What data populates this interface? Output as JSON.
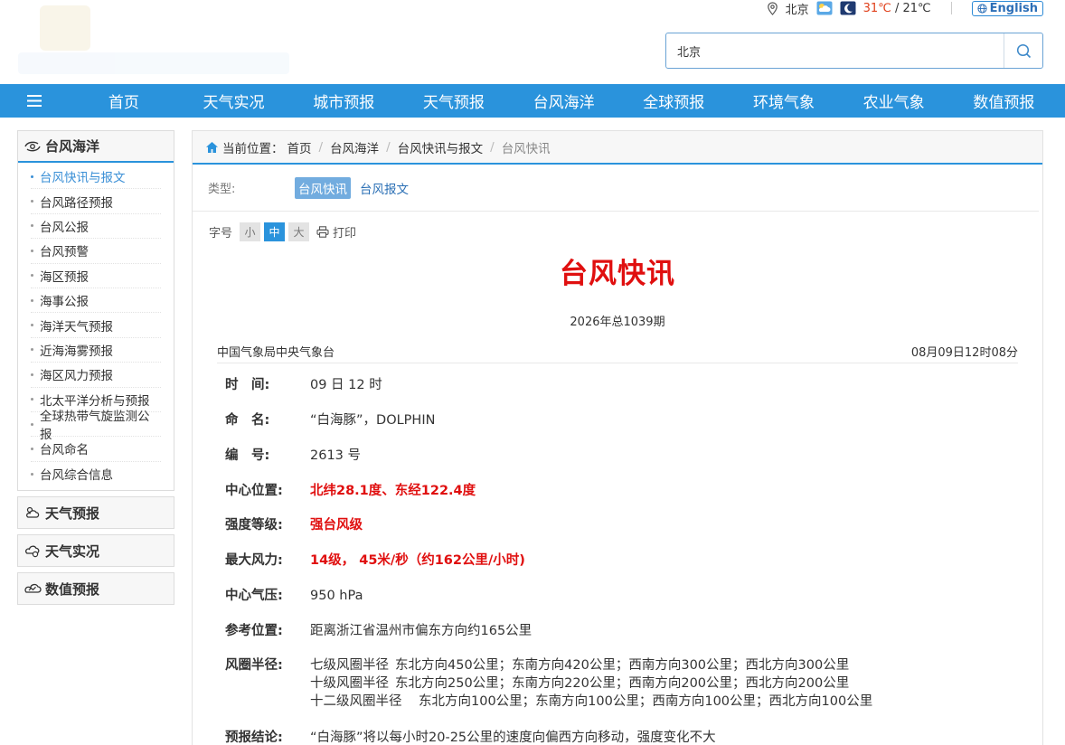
{
  "topbar": {
    "city": "北京",
    "temp_high": "31℃",
    "temp_sep": "/",
    "temp_low": "21℃",
    "english_label": "English"
  },
  "search": {
    "value": "北京"
  },
  "nav": {
    "items": [
      "首页",
      "天气实况",
      "城市预报",
      "天气预报",
      "台风海洋",
      "全球预报",
      "环境气象",
      "农业气象",
      "数值预报"
    ]
  },
  "sidebar": {
    "section_title": "台风海洋",
    "items": [
      {
        "label": "台风快讯与报文",
        "active": true
      },
      {
        "label": "台风路径预报"
      },
      {
        "label": "台风公报"
      },
      {
        "label": "台风预警"
      },
      {
        "label": "海区预报"
      },
      {
        "label": "海事公报"
      },
      {
        "label": "海洋天气预报"
      },
      {
        "label": "近海海雾预报"
      },
      {
        "label": "海区风力预报"
      },
      {
        "label": "北太平洋分析与预报"
      },
      {
        "label": "全球热带气旋监测公报"
      },
      {
        "label": "台风命名"
      },
      {
        "label": "台风综合信息"
      }
    ],
    "categories": [
      "天气预报",
      "天气实况",
      "数值预报"
    ]
  },
  "breadcrumb": {
    "prefix": "当前位置：",
    "items": [
      "首页",
      "台风海洋",
      "台风快讯与报文"
    ],
    "current": "台风快讯"
  },
  "type_filter": {
    "label": "类型:",
    "tags": [
      "台风快讯",
      "台风报文"
    ]
  },
  "font_controls": {
    "label": "字号",
    "small": "小",
    "medium": "中",
    "large": "大",
    "print": "打印"
  },
  "article": {
    "title": "台风快讯",
    "issue": "2026年总1039期",
    "source": "中国气象局中央气象台",
    "time": "08月09日12时08分",
    "rows": [
      {
        "key": "时　间:",
        "value": "09 日 12 时"
      },
      {
        "key": "命　名:",
        "value": "“白海豚”，DOLPHIN"
      },
      {
        "key": "编　号:",
        "value": "2613 号"
      },
      {
        "key": "中心位置:",
        "value": "北纬28.1度、东经122.4度"
      },
      {
        "key": "强度等级:",
        "value": "强台风级"
      },
      {
        "key": "最大风力:",
        "value": "14级， 45米/秒（约162公里/小时)"
      },
      {
        "key": "中心气压:",
        "value": "950 hPa"
      },
      {
        "key": "参考位置:",
        "value": "距离浙江省温州市偏东方向约165公里"
      },
      {
        "key": "风圈半径:",
        "lines": [
          {
            "pre": "七级风圈半径",
            "text": "东北方向450公里；东南方向420公里；西南方向300公里；西北方向300公里"
          },
          {
            "pre": "十级风圈半径",
            "text": "东北方向250公里；东南方向220公里；西南方向200公里；西北方向200公里"
          },
          {
            "pre": "十二级风圈半径",
            "text": "东北方向100公里；东南方向100公里；西南方向100公里；西北方向100公里"
          }
        ]
      },
      {
        "key": "预报结论:",
        "value": "“白海豚”将以每小时20-25公里的速度向偏西方向移动，强度变化不大"
      }
    ]
  }
}
